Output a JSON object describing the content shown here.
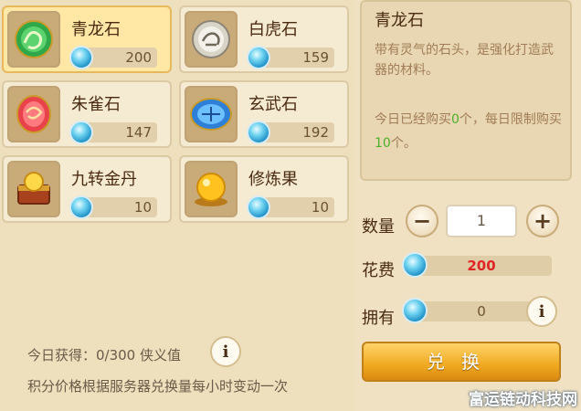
{
  "items": [
    {
      "name": "青龙石",
      "price": "200",
      "icon": "green-dragon-stone-icon",
      "selected": true
    },
    {
      "name": "白虎石",
      "price": "159",
      "icon": "white-tiger-stone-icon",
      "selected": false
    },
    {
      "name": "朱雀石",
      "price": "147",
      "icon": "vermilion-bird-stone-icon",
      "selected": false
    },
    {
      "name": "玄武石",
      "price": "192",
      "icon": "black-tortoise-stone-icon",
      "selected": false
    },
    {
      "name": "九转金丹",
      "price": "10",
      "icon": "golden-elixir-chest-icon",
      "selected": false
    },
    {
      "name": "修炼果",
      "price": "10",
      "icon": "cultivation-fruit-icon",
      "selected": false
    }
  ],
  "detail": {
    "title": "青龙石",
    "description": "带有灵气的石头，是强化打造武器的材料。",
    "limit_prefix": "今日已经购买",
    "limit_bought": "0",
    "limit_mid": "个，每日限制购买",
    "limit_max": "10",
    "limit_suffix": "个。"
  },
  "purchase": {
    "quantity_label": "数量",
    "quantity": "1",
    "cost_label": "花费",
    "cost": "200",
    "own_label": "拥有",
    "own": "0",
    "exchange_label": "兑换",
    "minus": "−",
    "plus": "+"
  },
  "footer": {
    "status": "今日获得：0/300 侠义值",
    "note": "积分价格根据服务器兑换量每小时变动一次",
    "info_glyph": "i"
  },
  "watermark": "富运链动科技网",
  "colors": {
    "accent": "#f0a820",
    "highlight": "#4caf2b",
    "cost": "#e02525",
    "currency": "#1c8fc7"
  }
}
